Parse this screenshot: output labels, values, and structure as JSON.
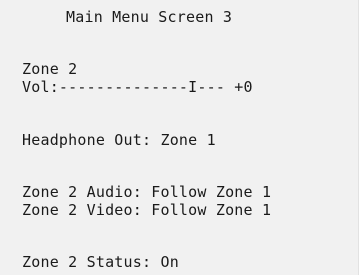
{
  "screen": {
    "title": "Main Menu Screen 3",
    "zone_label": "Zone 2",
    "volume_line": "Vol:--------------I--- +0",
    "headphone_out": "Headphone Out: Zone 1",
    "zone2_audio": "Zone 2 Audio: Follow Zone 1",
    "zone2_video": "Zone 2 Video: Follow Zone 1",
    "zone2_status": "Zone 2 Status: On"
  },
  "colors": {
    "background": "#f1f1f1",
    "text": "#1a1a1a"
  }
}
